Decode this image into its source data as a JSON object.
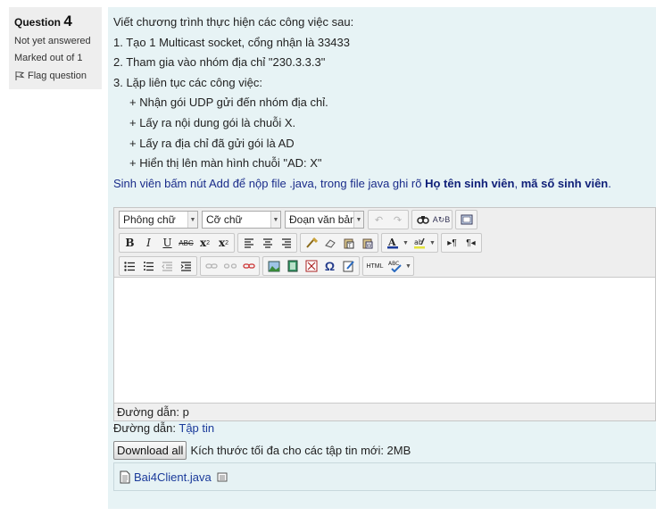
{
  "info": {
    "question_label": "Question",
    "question_number": "4",
    "state": "Not yet answered",
    "grade": "Marked out of 1",
    "flag_label": "Flag question"
  },
  "question": {
    "lines": [
      "Viết chương trình thực hiện các công việc sau:",
      "1. Tạo 1 Multicast socket, cổng nhận là 33433",
      "2. Tham gia vào nhóm địa chỉ \"230.3.3.3\"",
      "3. Lặp liên tục các công việc:",
      "+ Nhận gói UDP gửi đến nhóm địa chỉ.",
      "+ Lấy ra nội dung gói là chuỗi X.",
      "+ Lấy ra địa chỉ đã gửi gói là AD",
      "+ Hiển thị lên màn hình chuỗi \"AD:  X\""
    ],
    "instruction_prefix": "Sinh viên bấm nút Add để nộp file .java, trong file java ghi rõ ",
    "instruction_bold1": "Họ tên sinh viên",
    "instruction_sep": ", ",
    "instruction_bold2": "mã số sinh viên",
    "instruction_suffix": "."
  },
  "editor": {
    "font_family_select": "Phông chữ",
    "font_size_select": "Cỡ chữ",
    "format_select": "Đoạn văn bản",
    "path_label": "Đường dẫn:",
    "path_value": "p"
  },
  "files": {
    "path_label": "Đường dẫn:",
    "path_link": "Tập tin",
    "download_button": "Download all",
    "max_size_text": "Kích thước tối đa cho các tập tin mới: 2MB",
    "file_name": "Bai4Client.java"
  },
  "colors": {
    "content_bg": "#e7f3f5",
    "info_bg": "#eeeeee",
    "link": "#1a3a9a"
  }
}
